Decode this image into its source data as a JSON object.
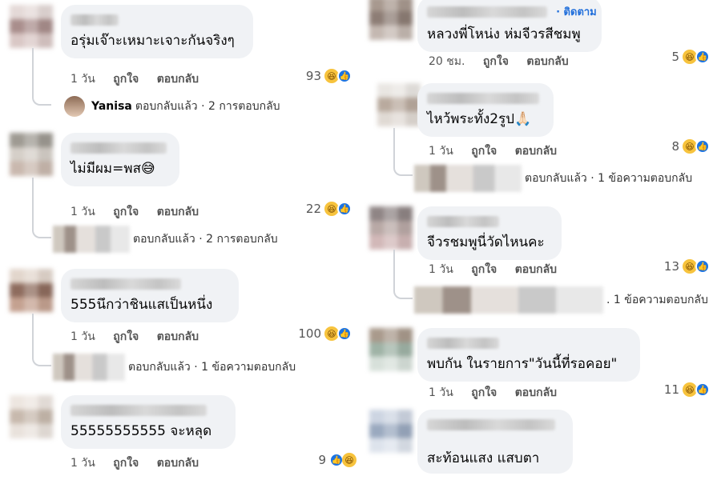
{
  "left": {
    "comments": [
      {
        "text": "อรุ่มเจ๊าะเหมาะเจาะกันจริงๆ",
        "time": "1 วัน",
        "like": "ถูกใจ",
        "reply": "ตอบกลับ",
        "count": "93",
        "reply_name": "Yanisa",
        "reply_text": "ตอบกลับแล้ว · 2 การตอบกลับ"
      },
      {
        "text": "ไม่มีผม=พส😅",
        "time": "1 วัน",
        "like": "ถูกใจ",
        "reply": "ตอบกลับ",
        "count": "22",
        "reply_text": "ตอบกลับแล้ว · 2 การตอบกลับ"
      },
      {
        "text": "555นึกว่าชินแสเป็นหนึ่ง",
        "time": "1 วัน",
        "like": "ถูกใจ",
        "reply": "ตอบกลับ",
        "count": "100",
        "reply_text": "ตอบกลับแล้ว · 1 ข้อความตอบกลับ"
      },
      {
        "text": "55555555555 จะหลุด",
        "time": "1 วัน",
        "like": "ถูกใจ",
        "reply": "ตอบกลับ",
        "count": "9"
      }
    ]
  },
  "right": {
    "comments": [
      {
        "follow": "· ติดตาม",
        "text": "หลวงพี่โหน่ง ห่มจีวรสีชมพู",
        "time": "20 ชม.",
        "like": "ถูกใจ",
        "reply": "ตอบกลับ",
        "count": "5"
      },
      {
        "text": "ไหว้พระทั้ง2รูป🙏🏻",
        "time": "1 วัน",
        "like": "ถูกใจ",
        "reply": "ตอบกลับ",
        "count": "8",
        "reply_text": "ตอบกลับแล้ว · 1 ข้อความตอบกลับ"
      },
      {
        "text": "จีวรชมพูนี่วัดไหนคะ",
        "time": "1 วัน",
        "like": "ถูกใจ",
        "reply": "ตอบกลับ",
        "count": "13",
        "reply_text": ". 1 ข้อความตอบกลับ"
      },
      {
        "text": "พบกัน ในรายการ\"วันนี้ที่รอคอย\"",
        "time": "1 วัน",
        "like": "ถูกใจ",
        "reply": "ตอบกลับ",
        "count": "11"
      },
      {
        "text": "สะท้อนแสง แสบตา"
      }
    ]
  },
  "icons": {
    "haha": "haha-reaction-icon",
    "like": "like-reaction-icon"
  },
  "colors": {
    "bubble": "#f0f2f5",
    "follow": "#216fdb",
    "like_blue": "#1b74e4",
    "haha_yellow": "#f7c33d"
  }
}
